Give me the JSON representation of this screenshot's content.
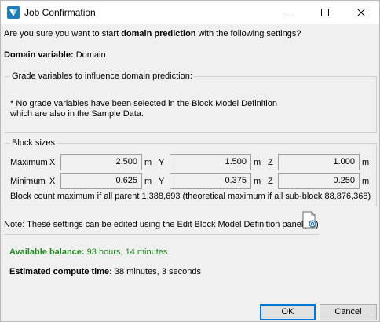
{
  "window": {
    "title": "Job Confirmation"
  },
  "prompt": {
    "pre": "Are you sure you want to start ",
    "bold": "domain prediction",
    "post": " with the following settings?"
  },
  "domain_variable": {
    "label": "Domain variable:",
    "value": "Domain"
  },
  "grade_group": {
    "label": "Grade variables to influence domain prediction:",
    "message_line1": "* No grade variables have been selected in the Block Model Definition",
    "message_line2": "which are also in the Sample Data."
  },
  "block_sizes": {
    "label": "Block sizes",
    "rows": [
      {
        "label": "Maximum",
        "x": "2.500",
        "y": "1.500",
        "z": "1.000"
      },
      {
        "label": "Minimum",
        "x": "0.625",
        "y": "0.375",
        "z": "0.250"
      }
    ],
    "axis_x": "X",
    "axis_y": "Y",
    "axis_z": "Z",
    "unit": "m",
    "count_text": "Block count maximum if all parent 1,388,693 (theoretical maximum if all sub-block 88,876,368)"
  },
  "note": {
    "text": "Note: These settings can be edited using the Edit Block Model Definition panel(",
    "close": ")"
  },
  "balance": {
    "label": "Available balance:",
    "value": "93 hours, 14 minutes"
  },
  "compute": {
    "label": "Estimated compute time:",
    "value": "38 minutes, 3 seconds"
  },
  "buttons": {
    "ok": "OK",
    "cancel": "Cancel"
  },
  "colors": {
    "balance_green": "#1f8a1f",
    "ok_border": "#0078d7"
  }
}
